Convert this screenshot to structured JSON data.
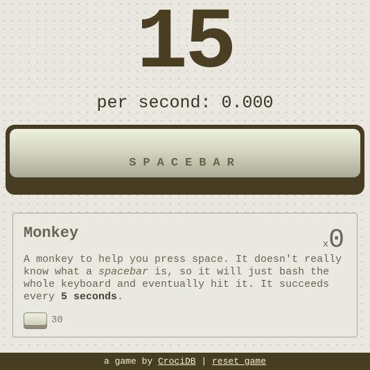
{
  "counter": {
    "value": "15"
  },
  "rate": {
    "label": "per second: 0.000"
  },
  "spacebar": {
    "label": "SPACEBAR"
  },
  "upgrades": [
    {
      "title": "Monkey",
      "count_prefix": "x",
      "count": "0",
      "description": {
        "part1": "A monkey to help you press space. It doesn't really know what a ",
        "emphasis": "spacebar",
        "part2": " is, so it will just bash the whole keyboard and eventually hit it. It succeeds every ",
        "interval": "5 seconds",
        "part3": "."
      },
      "cost": "30"
    }
  ],
  "footer": {
    "prefix": "a game by ",
    "author_link": "CrociDB",
    "separator": " | ",
    "reset_link": "reset game"
  },
  "colors": {
    "background": "#e9e7df",
    "accent_dark": "#463d22",
    "key_face": "#d3d5c0",
    "footer_text": "#f4edd1"
  }
}
